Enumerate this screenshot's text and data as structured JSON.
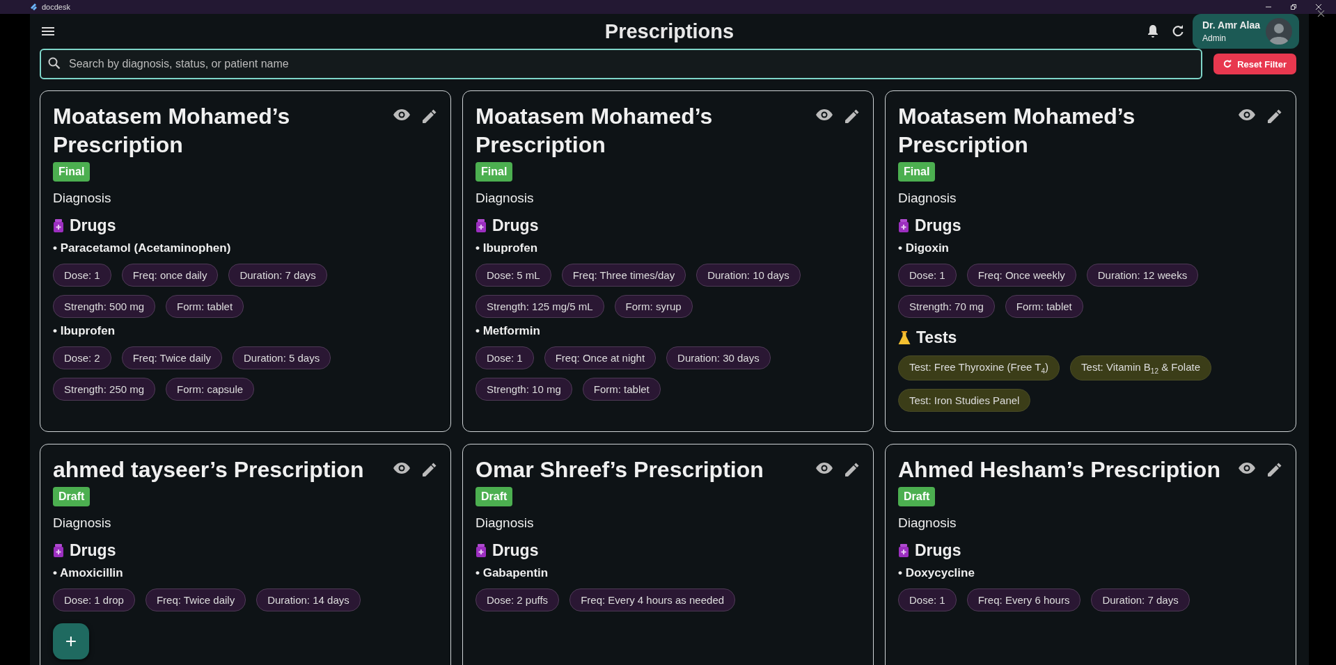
{
  "window": {
    "title": "docdesk"
  },
  "header": {
    "title": "Prescriptions",
    "user": {
      "name": "Dr. Amr Alaa",
      "role": "Admin"
    }
  },
  "search": {
    "placeholder": "Search by diagnosis, status, or patient name"
  },
  "reset_button": {
    "label": "Reset Filter"
  },
  "cards": [
    {
      "title": "Moatasem Mohamed’s Prescription",
      "status": "Final",
      "diagnosis": "Diagnosis",
      "drugs_heading": "Drugs",
      "drugs": [
        {
          "name": "• Paracetamol (Acetaminophen)",
          "details": [
            "Dose: 1",
            "Freq: once daily",
            "Duration: 7 days",
            "Strength: 500 mg",
            "Form: tablet"
          ]
        },
        {
          "name": "• Ibuprofen",
          "details": [
            "Dose: 2",
            "Freq: Twice daily",
            "Duration: 5 days",
            "Strength: 250 mg",
            "Form: capsule"
          ]
        }
      ]
    },
    {
      "title": "Moatasem Mohamed’s Prescription",
      "status": "Final",
      "diagnosis": "Diagnosis",
      "drugs_heading": "Drugs",
      "drugs": [
        {
          "name": "• Ibuprofen",
          "details": [
            "Dose: 5 mL",
            "Freq: Three times/day",
            "Duration: 10 days",
            "Strength: 125 mg/5 mL",
            "Form: syrup"
          ]
        },
        {
          "name": "• Metformin",
          "details": [
            "Dose: 1",
            "Freq: Once at night",
            "Duration: 30 days",
            "Strength: 10 mg",
            "Form: tablet"
          ]
        }
      ]
    },
    {
      "title": "Moatasem Mohamed’s Prescription",
      "status": "Final",
      "diagnosis": "Diagnosis",
      "drugs_heading": "Drugs",
      "drugs": [
        {
          "name": "• Digoxin",
          "details": [
            "Dose: 1",
            "Freq: Once weekly",
            "Duration: 12 weeks",
            "Strength: 70 mg",
            "Form: tablet"
          ]
        }
      ],
      "tests_heading": "Tests",
      "tests": [
        "Test: Free Thyroxine (Free T$_{4}$)",
        "Test: Vitamin B$_{12}$ & Folate",
        "Test: Iron Studies Panel"
      ]
    },
    {
      "title": "ahmed tayseer’s Prescription",
      "status": "Draft",
      "diagnosis": "Diagnosis",
      "drugs_heading": "Drugs",
      "drugs": [
        {
          "name": "• Amoxicillin",
          "details": [
            "Dose: 1 drop",
            "Freq: Twice daily",
            "Duration: 14 days"
          ]
        }
      ]
    },
    {
      "title": "Omar Shreef’s Prescription",
      "status": "Draft",
      "diagnosis": "Diagnosis",
      "drugs_heading": "Drugs",
      "drugs": [
        {
          "name": "• Gabapentin",
          "details": [
            "Dose: 2 puffs",
            "Freq: Every 4 hours as needed"
          ]
        }
      ]
    },
    {
      "title": "Ahmed Hesham’s Prescription",
      "status": "Draft",
      "diagnosis": "Diagnosis",
      "drugs_heading": "Drugs",
      "drugs": [
        {
          "name": "• Doxycycline",
          "details": [
            "Dose: 1",
            "Freq: Every 6 hours",
            "Duration: 7 days"
          ]
        }
      ]
    }
  ],
  "fab": {
    "label": "+"
  }
}
